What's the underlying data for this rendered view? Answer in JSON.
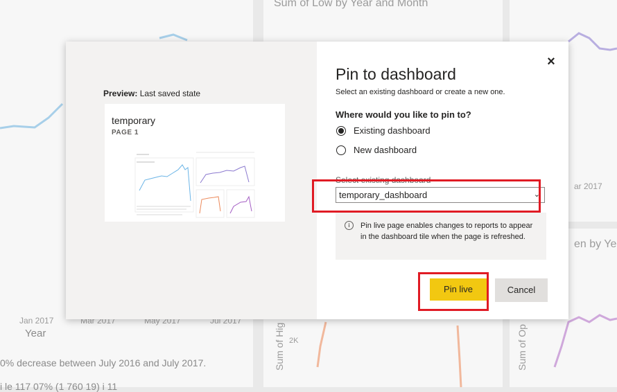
{
  "background": {
    "chart_title": "Sum of Low by Year and Month",
    "x_ticks": [
      "Jan 2017",
      "Mar 2017",
      "May 2017",
      "Jul 2017"
    ],
    "x_axis_label": "Year",
    "right_tick": "ar 2017",
    "right_chart_title_fragment": "en by Ye",
    "y_label_high": "Sum of Hig",
    "y_label_open": "Sum of Op",
    "y_tick": "2K",
    "note_line1": "0% decrease between July 2016 and July 2017.",
    "note_line2": "i le  117 07% (1 760 19)  i  11"
  },
  "dialog": {
    "preview_label": "Preview:",
    "preview_state": "Last saved state",
    "thumbnail": {
      "title": "temporary",
      "page": "PAGE 1"
    },
    "close_label": "×",
    "title": "Pin to dashboard",
    "subtitle": "Select an existing dashboard or create a new one.",
    "question": "Where would you like to pin to?",
    "options": [
      {
        "label": "Existing dashboard",
        "selected": true
      },
      {
        "label": "New dashboard",
        "selected": false
      }
    ],
    "select_label": "Select existing dashboard",
    "select_value": "temporary_dashboard",
    "chevron": "⌄",
    "info_icon": "i",
    "info_text": "Pin live page enables changes to reports to appear in the dashboard tile when the page is refreshed.",
    "pin_button": "Pin live",
    "cancel_button": "Cancel"
  },
  "colors": {
    "accent_yellow": "#f2c811",
    "highlight_red": "#e01b24"
  }
}
